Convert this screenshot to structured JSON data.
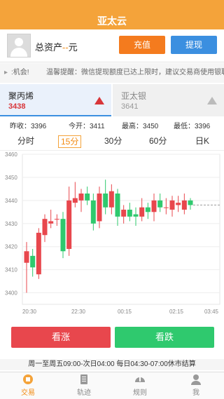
{
  "app": {
    "title": "亚太云"
  },
  "account": {
    "assets_label": "总资产",
    "assets_value": "--",
    "unit": "元",
    "recharge": "充值",
    "withdraw": "提现"
  },
  "notice": {
    "text1": ":机会!",
    "text2": "温馨提醒：微信提现额度已达上限时，建议交易商使用银联提"
  },
  "products": [
    {
      "name": "聚丙烯",
      "price": "3438"
    },
    {
      "name": "亚太银",
      "price": "3641"
    }
  ],
  "stats": {
    "prev_close": "昨收：3396",
    "open": "今开：3411",
    "high": "最高：3450",
    "low": "最低：3396"
  },
  "periods": [
    "分时",
    "15分",
    "30分",
    "60分",
    "日K"
  ],
  "active_period": "15分",
  "chart_data": {
    "type": "candlestick",
    "y_ticks": [
      "3460",
      "3450",
      "3440",
      "3430",
      "3420",
      "3410",
      "3400"
    ],
    "ylim": [
      3395,
      3460
    ],
    "x_ticks": [
      "20:30",
      "22:30",
      "00:15",
      "02:15",
      "03:45"
    ],
    "candles": [
      [
        3413,
        3418,
        3400,
        3422
      ],
      [
        3416,
        3411,
        3407,
        3419
      ],
      [
        3408,
        3426,
        3406,
        3428
      ],
      [
        3425,
        3432,
        3422,
        3434
      ],
      [
        3430,
        3431,
        3428,
        3436
      ],
      [
        3432,
        3432,
        3429,
        3434
      ],
      [
        3432,
        3418,
        3415,
        3435
      ],
      [
        3419,
        3440,
        3416,
        3446
      ],
      [
        3439,
        3441,
        3437,
        3448
      ],
      [
        3440,
        3443,
        3435,
        3445
      ],
      [
        3443,
        3440,
        3438,
        3446
      ],
      [
        3440,
        3430,
        3427,
        3443
      ],
      [
        3431,
        3443,
        3428,
        3446
      ],
      [
        3443,
        3437,
        3434,
        3449
      ],
      [
        3437,
        3444,
        3434,
        3447
      ],
      [
        3443,
        3433,
        3429,
        3445
      ],
      [
        3433,
        3436,
        3430,
        3438
      ],
      [
        3436,
        3433,
        3431,
        3439
      ],
      [
        3434,
        3433,
        3429,
        3437
      ],
      [
        3433,
        3437,
        3431,
        3441
      ],
      [
        3437,
        3435,
        3432,
        3439
      ],
      [
        3435,
        3440,
        3431,
        3443
      ],
      [
        3440,
        3437,
        3435,
        3443
      ],
      [
        3437,
        3437,
        3434,
        3441
      ],
      [
        3436,
        3440,
        3433,
        3442
      ],
      [
        3438,
        3439,
        3435,
        3442
      ],
      [
        3436,
        3440,
        3434,
        3443
      ],
      [
        3440,
        3438,
        3436,
        3441
      ]
    ],
    "last_price": 3438
  },
  "actions": {
    "rise": "看涨",
    "fall": "看跌"
  },
  "hours": "周一至周五09:00-次日04:00 每日04:30-07:00休市结算",
  "nav": [
    {
      "label": "交易",
      "icon": "trade-icon"
    },
    {
      "label": "轨迹",
      "icon": "track-icon"
    },
    {
      "label": "规则",
      "icon": "rules-icon"
    },
    {
      "label": "我",
      "icon": "profile-icon"
    }
  ],
  "colors": {
    "brand": "#f4a33a",
    "up": "#e8474d",
    "down": "#2fc96e",
    "blue": "#3b8fe0"
  }
}
